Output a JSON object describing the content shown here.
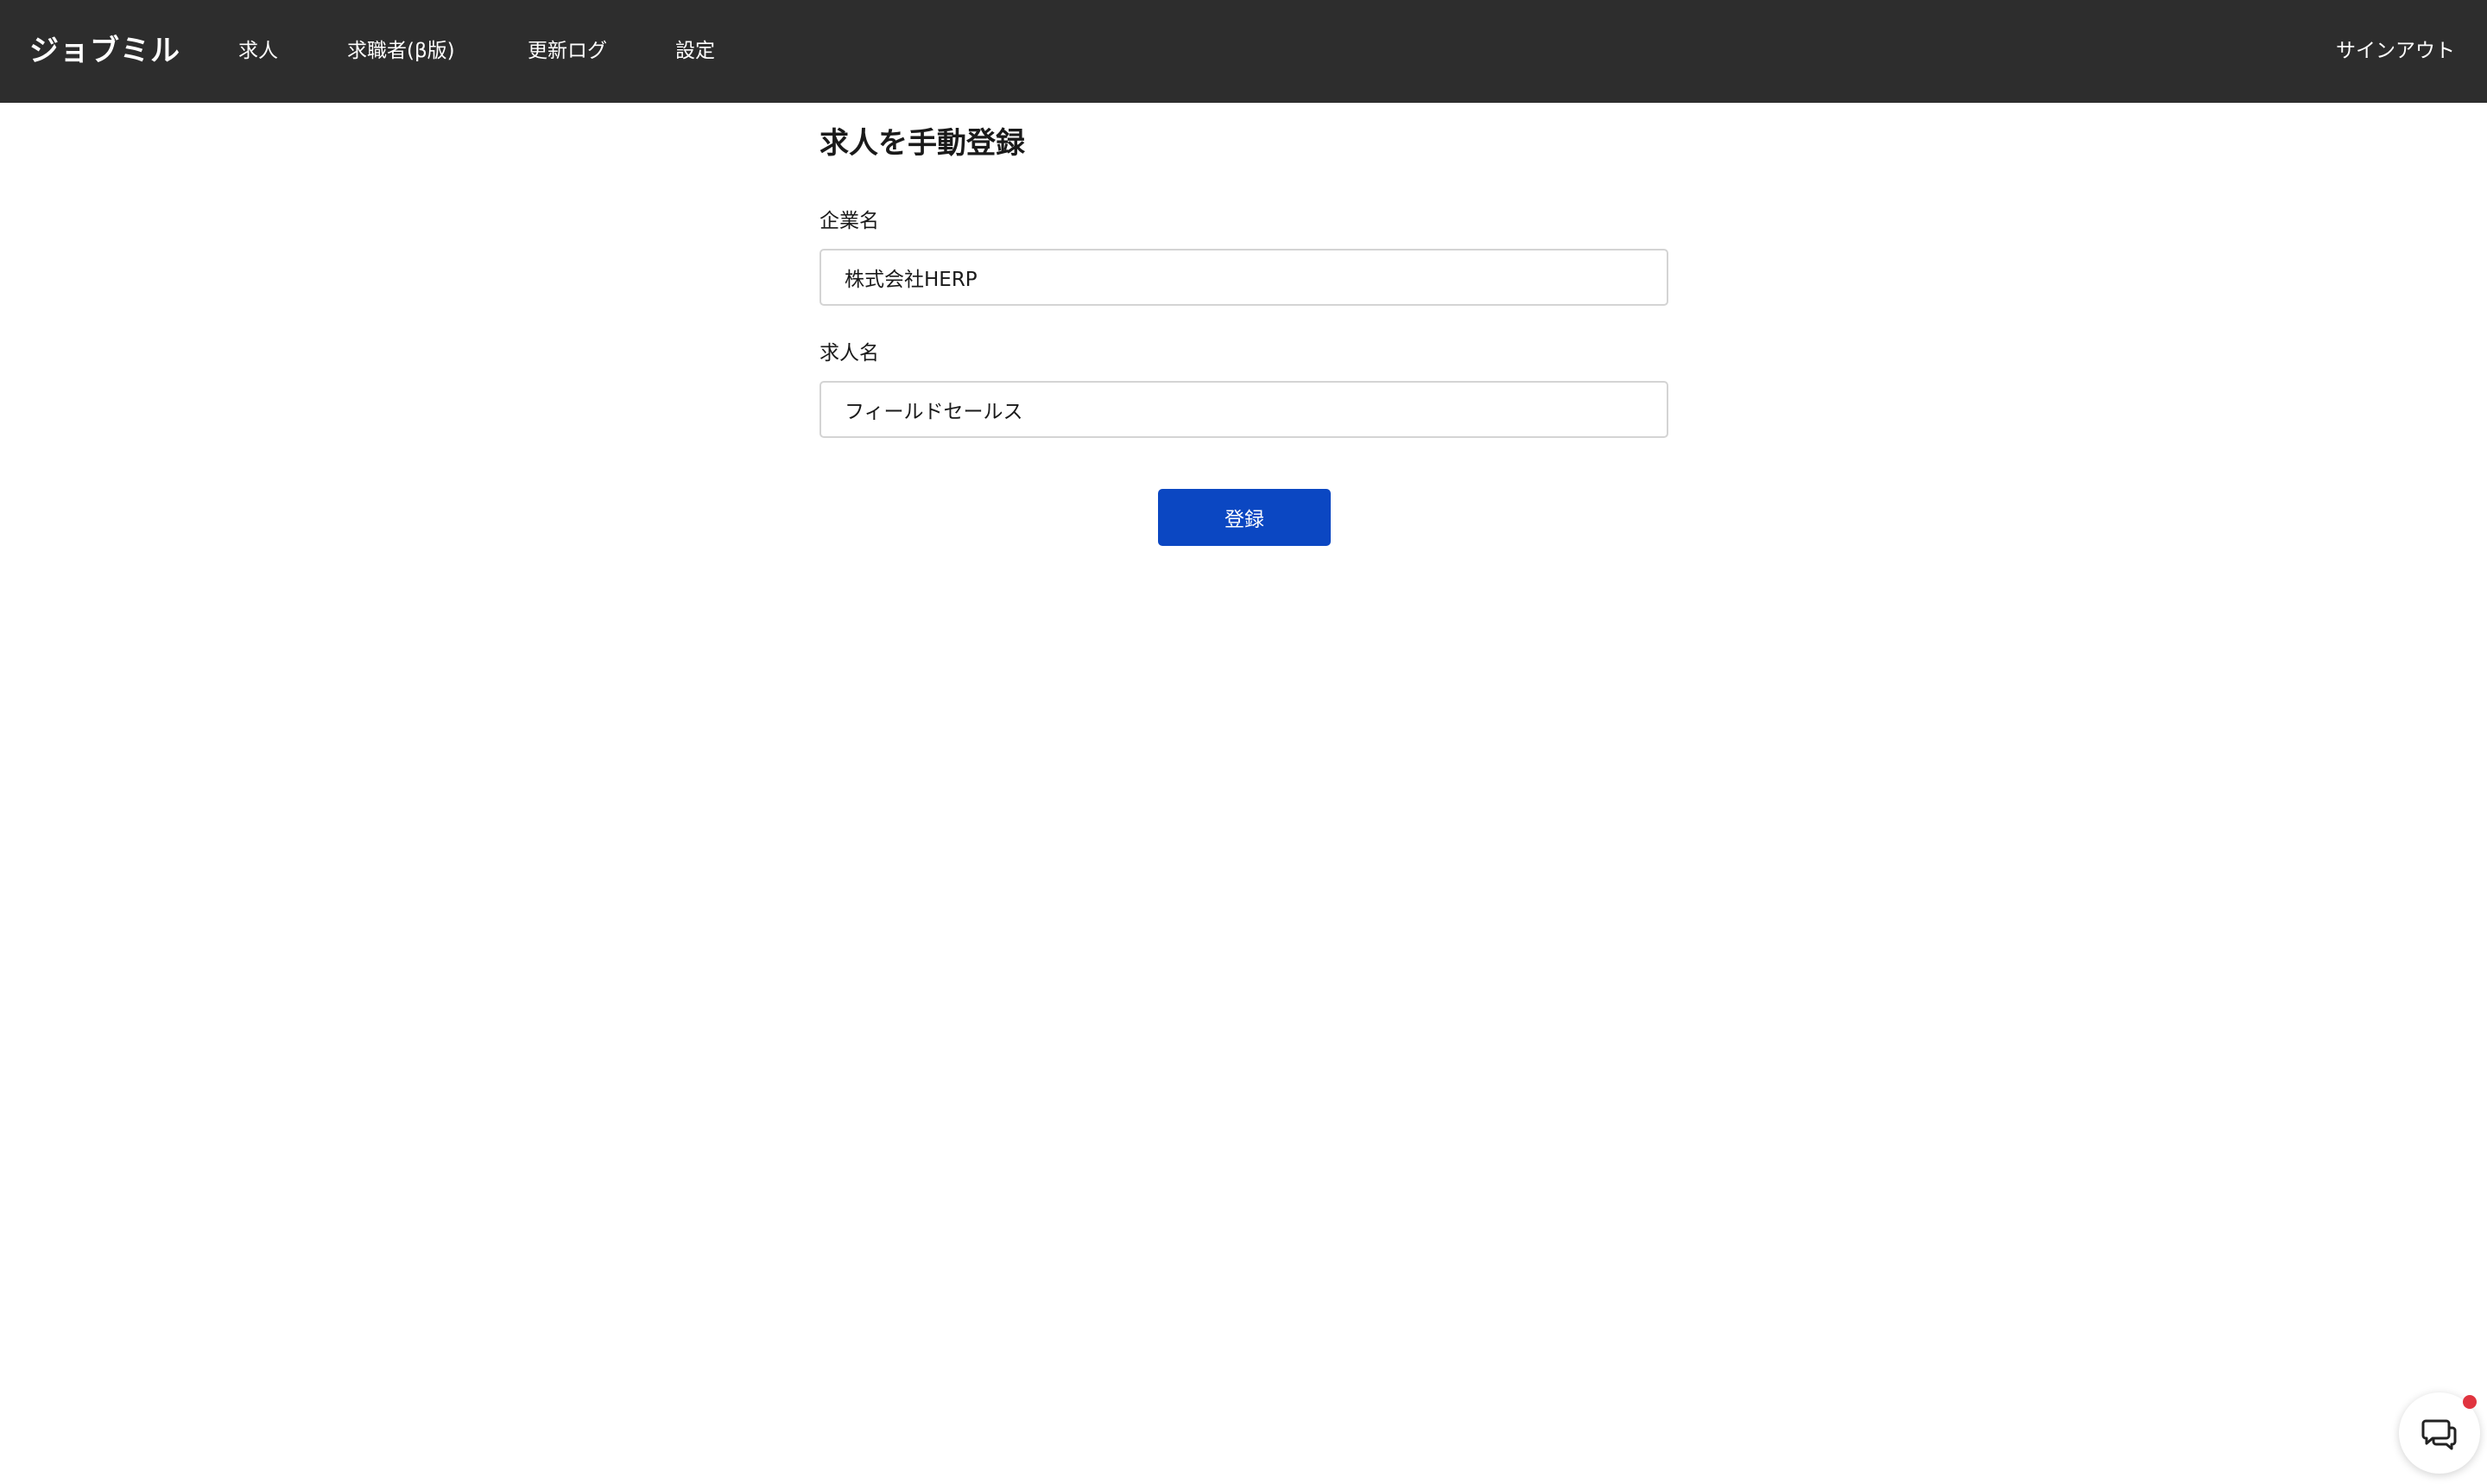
{
  "header": {
    "brand": "ジョブミル",
    "nav": {
      "jobs": "求人",
      "seekers": "求職者(β版)",
      "changelog": "更新ログ",
      "settings": "設定"
    },
    "signout": "サインアウト"
  },
  "form": {
    "title": "求人を手動登録",
    "company_label": "企業名",
    "company_value": "株式会社HERP",
    "job_label": "求人名",
    "job_value": "フィールドセールス",
    "submit_label": "登録"
  },
  "chat": {
    "icon": "chat-bubbles-icon",
    "has_notification": true
  },
  "colors": {
    "header_bg": "#2d2d2d",
    "primary": "#0b47c2",
    "notification": "#e0343f"
  }
}
